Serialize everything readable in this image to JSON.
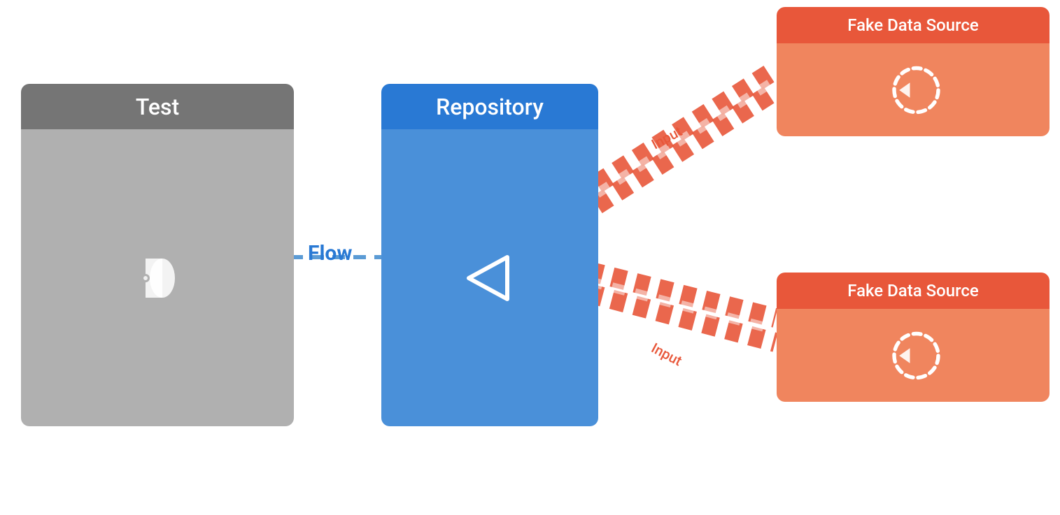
{
  "test_block": {
    "header": "Test"
  },
  "repo_block": {
    "header": "Repository"
  },
  "fds_top": {
    "header": "Fake Data Source"
  },
  "fds_bottom": {
    "header": "Fake Data Source"
  },
  "flow_label": "Flow",
  "input_label_top": "Input",
  "input_label_bottom": "Input",
  "colors": {
    "test_header": "#757575",
    "test_body": "#b0b0b0",
    "repo_header": "#2979d4",
    "repo_body": "#4a90d9",
    "fds_header": "#e8573a",
    "fds_body": "#f0855e",
    "flow_text": "#2979d4",
    "input_text": "#e8573a",
    "dashed_line": "#5b9bd5",
    "dashed_line_orange": "#e8573a"
  }
}
